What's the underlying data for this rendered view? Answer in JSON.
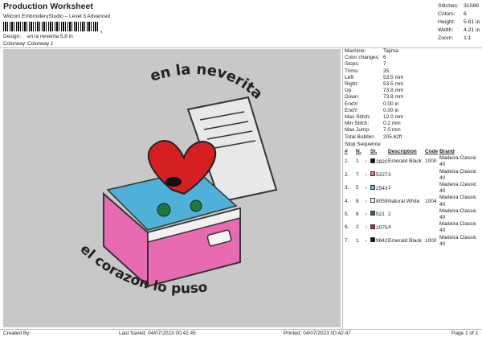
{
  "header": {
    "title": "Production Worksheet",
    "subtitle": "Wilcom EmbroideryStudio – Level 3 Advanced",
    "barcode_mark": ",",
    "design_label": "Design:",
    "design_value": "en la neverita 5,8 in",
    "colorway_label": "Colorway:",
    "colorway_value": "Colorway 1"
  },
  "stats": [
    {
      "k": "Stitches:",
      "v": "31089"
    },
    {
      "k": "Colors:",
      "v": "6"
    },
    {
      "k": "Height:",
      "v": "5.81 in"
    },
    {
      "k": "Width:",
      "v": "4.21 in"
    },
    {
      "k": "Zoom:",
      "v": "1:1"
    }
  ],
  "design_text": {
    "top": "en la neverita",
    "bottom": "el corazon lo puso"
  },
  "machine_info": [
    {
      "k": "Machine:",
      "v": "Tajima"
    },
    {
      "k": "Color changes:",
      "v": "6"
    },
    {
      "k": "Stops:",
      "v": "7"
    },
    {
      "k": "Trims:",
      "v": "35"
    },
    {
      "k": "Left:",
      "v": "53.5 mm"
    },
    {
      "k": "Right:",
      "v": "53.5 mm"
    },
    {
      "k": "Up:",
      "v": "73.8 mm"
    },
    {
      "k": "Down:",
      "v": "73.8 mm"
    },
    {
      "k": "EndX:",
      "v": "0.00 in"
    },
    {
      "k": "EndY:",
      "v": "0.00 in"
    },
    {
      "k": "Max Stitch:",
      "v": "12.0 mm"
    },
    {
      "k": "Min Stitch:",
      "v": "0.2 mm"
    },
    {
      "k": "Max Jump:",
      "v": "7.0 mm"
    },
    {
      "k": "Total Bobbin:",
      "v": "205.62ft"
    }
  ],
  "stop_sequence_label": "Stop Sequence:",
  "stop_headers": [
    "#",
    "N.",
    "St.",
    "Description",
    "Code",
    "Brand"
  ],
  "stops": [
    {
      "n": "1.",
      "needle": "1",
      "st": "2820",
      "desc": "Emerald Black",
      "code": "1000",
      "brand": "Madeira Classic 40",
      "color": "#111111"
    },
    {
      "n": "2.",
      "needle": "7",
      "st": "5227",
      "desc": "3",
      "code": "",
      "brand": "Madeira Classic 40",
      "color": "#e86ab0"
    },
    {
      "n": "3.",
      "needle": "5",
      "st": "2543",
      "desc": "1",
      "code": "",
      "brand": "Madeira Classic 40",
      "color": "#5ab8e0"
    },
    {
      "n": "4.",
      "needle": "8",
      "st": "8059",
      "desc": "Natural White",
      "code": "1004",
      "brand": "Madeira Classic 40",
      "color": "#f4f4f4"
    },
    {
      "n": "5.",
      "needle": "6",
      "st": "521",
      "desc": "2",
      "code": "",
      "brand": "Madeira Classic 40",
      "color": "#1e7a3a"
    },
    {
      "n": "6.",
      "needle": "2",
      "st": "2075",
      "desc": "4",
      "code": "",
      "brand": "Madeira Classic 40",
      "color": "#d42020"
    },
    {
      "n": "7.",
      "needle": "1",
      "st": "9842",
      "desc": "Emerald Black",
      "code": "1000",
      "brand": "Madeira Classic 40",
      "color": "#111111"
    }
  ],
  "footer": {
    "created_by": "Created By:",
    "last_saved": "Last Saved: 04/07/2023 00:42:45",
    "printed": "Printed: 04/07/2023 00:42:47",
    "page": "Page 1 of 1"
  }
}
